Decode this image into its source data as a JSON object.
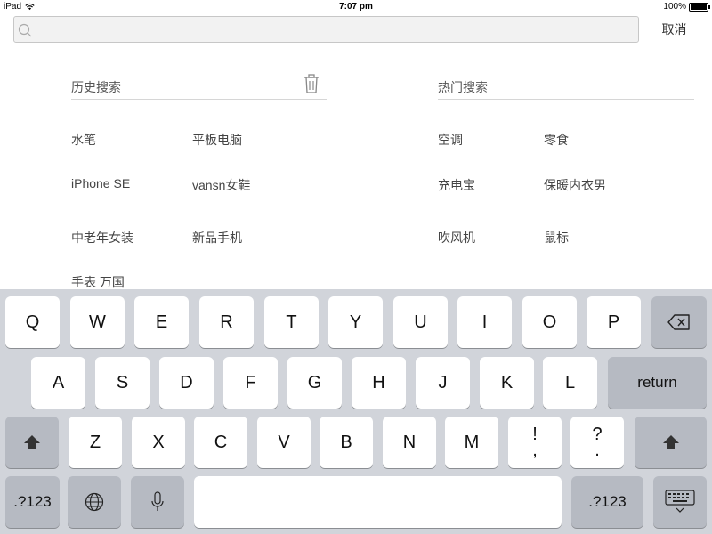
{
  "status_bar": {
    "device": "iPad",
    "time": "7:07 pm",
    "battery": "100%",
    "battery_level": 1.0
  },
  "search": {
    "value": "",
    "placeholder": "",
    "cancel_label": "取消"
  },
  "history": {
    "title": "历史搜索",
    "items": [
      "水笔",
      "平板电脑",
      "iPhone SE",
      "vansn女鞋",
      "中老年女装",
      "新品手机",
      "手表 万国"
    ]
  },
  "hot": {
    "title": "热门搜索",
    "items": [
      "空调",
      "零食",
      "充电宝",
      "保暖内衣男",
      "吹风机",
      "鼠标"
    ]
  },
  "keyboard": {
    "row1": [
      "Q",
      "W",
      "E",
      "R",
      "T",
      "Y",
      "U",
      "I",
      "O",
      "P"
    ],
    "row2": [
      "A",
      "S",
      "D",
      "F",
      "G",
      "H",
      "J",
      "K",
      "L"
    ],
    "row3": [
      "Z",
      "X",
      "C",
      "V",
      "B",
      "N",
      "M"
    ],
    "punct1_top": "!",
    "punct1_bottom": ",",
    "punct2_top": "?",
    "punct2_bottom": ".",
    "return_label": "return",
    "numbers_label": ".?123",
    "numbers_label_right": ".?123"
  },
  "colors": {
    "keyboard_bg": "#d1d4da",
    "key_bg": "#ffffff",
    "special_key_bg": "#b6bac2",
    "divider": "#d6d6d6"
  }
}
